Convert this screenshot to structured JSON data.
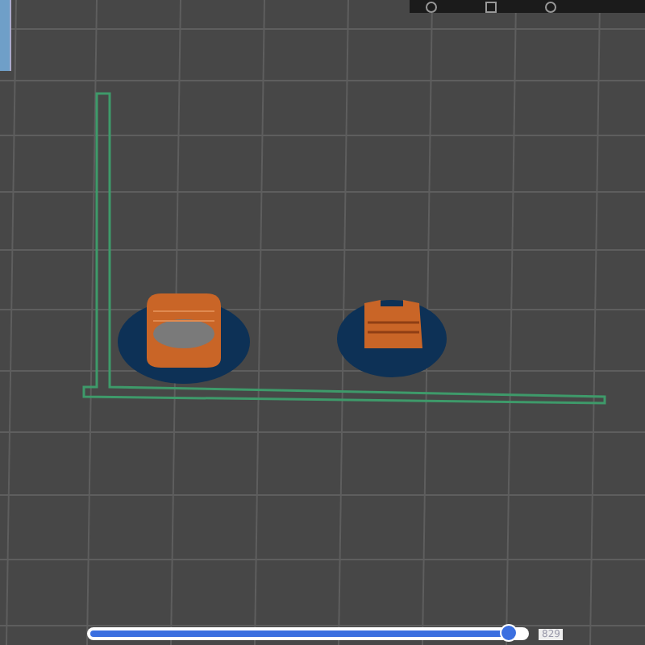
{
  "layer_slider": {
    "level": 0.965,
    "reading": "829"
  }
}
